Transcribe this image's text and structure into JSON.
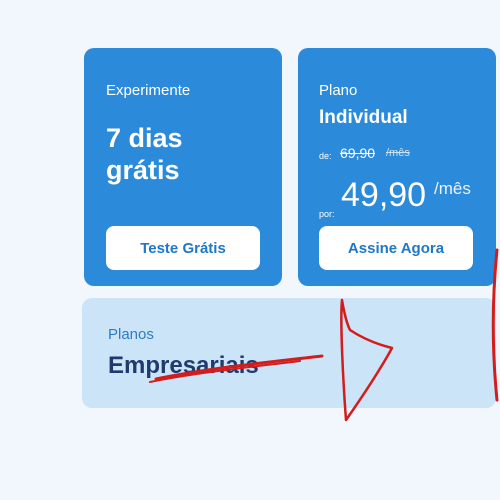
{
  "trial": {
    "eyebrow": "Experimente",
    "headline_line1": "7 dias",
    "headline_line2": "grátis",
    "button_label": "Teste Grátis"
  },
  "individual": {
    "eyebrow": "Plano",
    "title": "Individual",
    "from_label": "de:",
    "old_price": "69,90",
    "old_unit": "/mês",
    "by_label": "por:",
    "new_price": "49,90",
    "new_unit": "/mês",
    "button_label": "Assine Agora"
  },
  "business": {
    "eyebrow": "Planos",
    "title": "Empresariais"
  },
  "colors": {
    "card_blue": "#2b8ad9",
    "business_bg": "#cce4f8",
    "annotation_red": "#d31c1c"
  }
}
